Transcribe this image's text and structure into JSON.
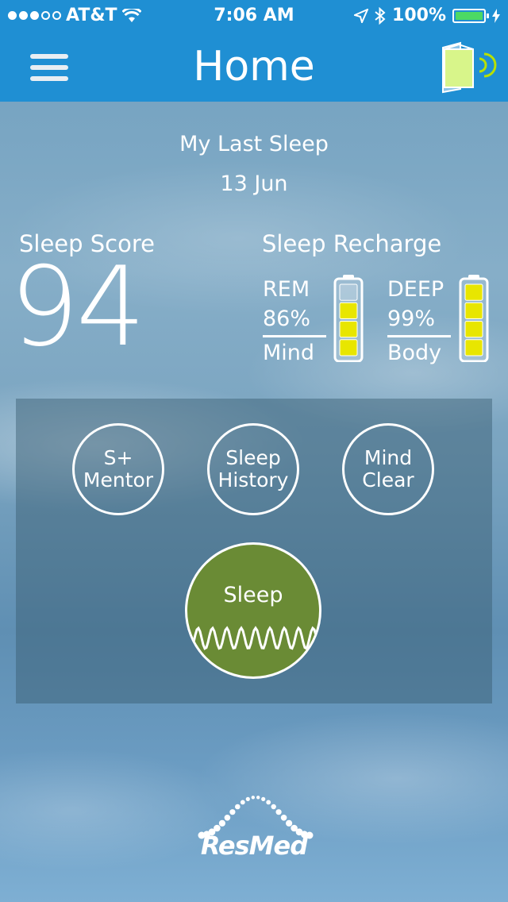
{
  "status_bar": {
    "carrier": "AT&T",
    "time": "7:06 AM",
    "battery": "100%"
  },
  "nav": {
    "title": "Home"
  },
  "last_sleep": {
    "heading": "My Last Sleep",
    "date": "13 Jun"
  },
  "sleep_score": {
    "label": "Sleep Score",
    "value": "94"
  },
  "sleep_recharge": {
    "label": "Sleep Recharge",
    "rem": {
      "name": "REM",
      "percent": "86%",
      "caption": "Mind",
      "level": 0.86
    },
    "deep": {
      "name": "DEEP",
      "percent": "99%",
      "caption": "Body",
      "level": 0.99
    }
  },
  "actions": {
    "mentor_line1": "S+",
    "mentor_line2": "Mentor",
    "history_line1": "Sleep",
    "history_line2": "History",
    "mindclear_line1": "Mind",
    "mindclear_line2": "Clear",
    "sleep": "Sleep"
  },
  "brand": {
    "logo_text": "ResMed"
  },
  "colors": {
    "nav_bar": "#1f8fd3",
    "sleep_button": "#6a8b35",
    "battery_level": "#e8e600",
    "status_battery": "#4cd964"
  }
}
